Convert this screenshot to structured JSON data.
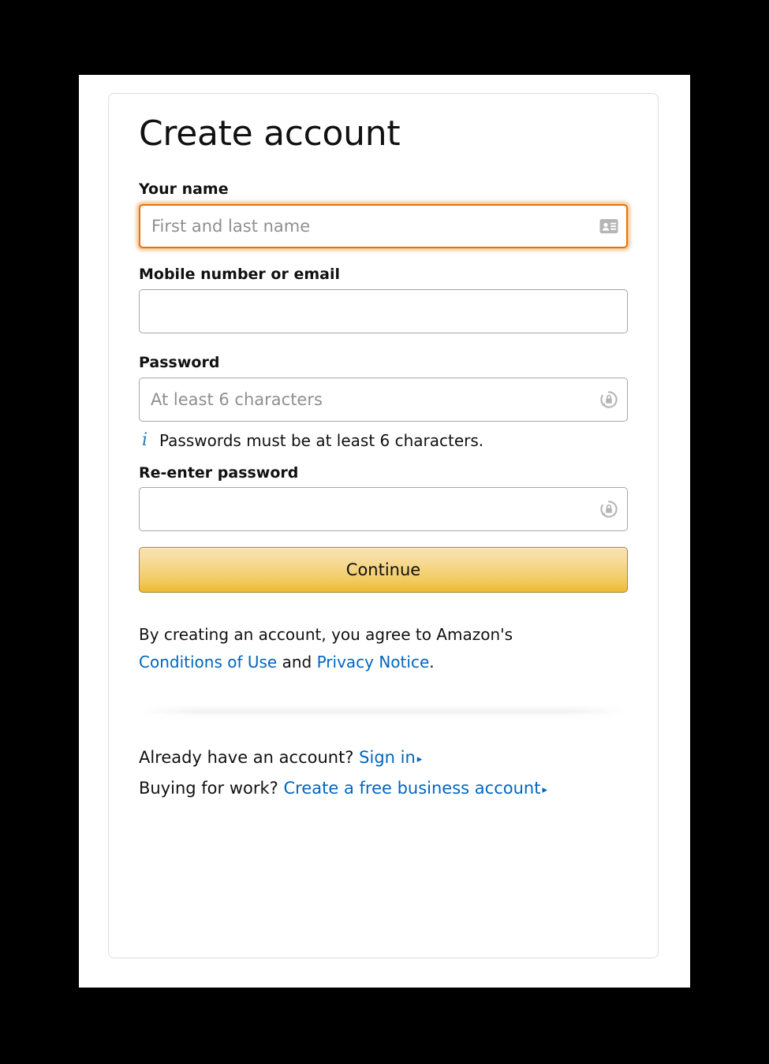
{
  "page": {
    "title": "Create account"
  },
  "form": {
    "name": {
      "label": "Your name",
      "placeholder": "First and last name",
      "value": "",
      "icon": "contact-card-icon",
      "focused": true
    },
    "login": {
      "label": "Mobile number or email",
      "placeholder": "",
      "value": "",
      "icon": "",
      "focused": false
    },
    "password": {
      "label": "Password",
      "placeholder": "At least 6 characters",
      "value": "",
      "icon": "password-manager-icon",
      "focused": false,
      "hint": "Passwords must be at least 6 characters.",
      "hint_icon": "info-icon"
    },
    "password_confirm": {
      "label": "Re-enter password",
      "placeholder": "",
      "value": "",
      "icon": "password-manager-icon",
      "focused": false
    },
    "submit_label": "Continue"
  },
  "legal": {
    "intro": "By creating an account, you agree to Amazon's",
    "conditions_link": "Conditions of Use",
    "conjunction": "and",
    "privacy_link": "Privacy Notice",
    "period": "."
  },
  "footer": {
    "signin_prompt": "Already have an account?",
    "signin_link": "Sign in",
    "business_prompt": "Buying for work?",
    "business_link": "Create a free business account",
    "caret_glyph": "▸"
  },
  "colors": {
    "accent_orange": "#e77600",
    "link_blue": "#0066c0",
    "button_gold": "#f0c14b",
    "button_border": "#a88734",
    "info_blue": "#2b7bb9",
    "field_border": "#a6a6a6",
    "card_border": "#ddddde",
    "backdrop": "#000000"
  }
}
